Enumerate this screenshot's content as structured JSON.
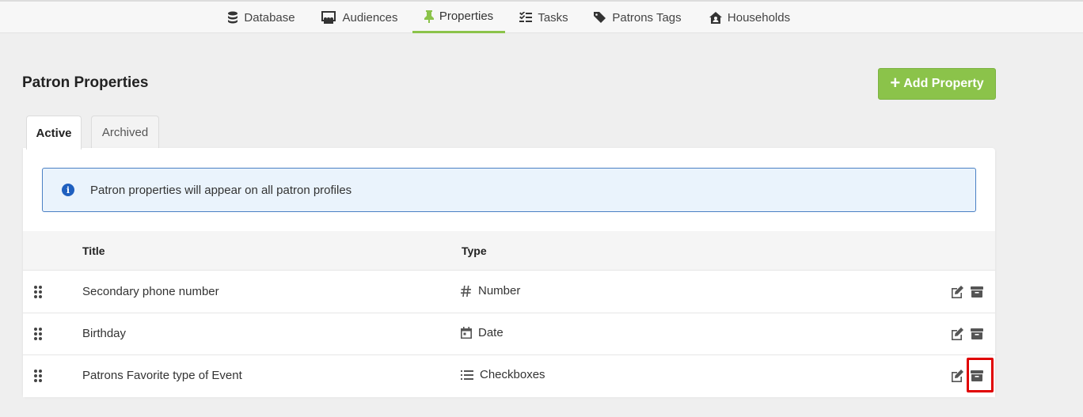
{
  "nav": {
    "items": [
      {
        "label": "Database",
        "icon": "database-icon"
      },
      {
        "label": "Audiences",
        "icon": "audiences-icon"
      },
      {
        "label": "Properties",
        "icon": "pin-icon",
        "active": true
      },
      {
        "label": "Tasks",
        "icon": "tasks-icon"
      },
      {
        "label": "Patrons Tags",
        "icon": "tags-icon"
      },
      {
        "label": "Households",
        "icon": "household-icon"
      }
    ]
  },
  "page": {
    "title": "Patron Properties",
    "add_button": "Add Property",
    "add_button_icon": "+"
  },
  "tabs": [
    {
      "label": "Active",
      "active": true
    },
    {
      "label": "Archived",
      "active": false
    }
  ],
  "info": {
    "icon": "i",
    "text": "Patron properties will appear on all patron profiles"
  },
  "table": {
    "headers": {
      "title": "Title",
      "type": "Type"
    },
    "rows": [
      {
        "title": "Secondary phone number",
        "type": "Number",
        "type_icon": "hash-icon"
      },
      {
        "title": "Birthday",
        "type": "Date",
        "type_icon": "calendar-icon"
      },
      {
        "title": "Patrons Favorite type of Event",
        "type": "Checkboxes",
        "type_icon": "list-icon",
        "archive_highlighted": true
      }
    ]
  },
  "colors": {
    "accent": "#8bc34a",
    "info_border": "#4a80c4",
    "info_bg": "#eaf3fc",
    "highlight": "#e00000"
  }
}
